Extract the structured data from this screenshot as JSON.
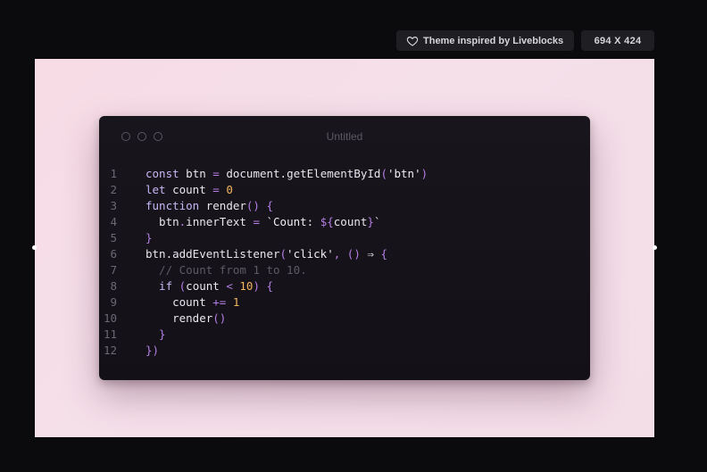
{
  "badges": {
    "theme_label": "Theme inspired by Liveblocks",
    "theme_icon": "heart-icon",
    "size_label": "694 X 424"
  },
  "window": {
    "title": "Untitled",
    "colors": {
      "background": "#16131a",
      "keyword": "#c7b7f6",
      "punctuation": "#b67ee6",
      "number": "#f3b55e",
      "comment": "#5e5966",
      "text": "#e9e6ee"
    }
  },
  "canvas": {
    "background_start": "#f7dbe5",
    "background_end": "#f3dde7"
  },
  "code": [
    {
      "n": "1",
      "tokens": [
        [
          "kw",
          "const"
        ],
        [
          "pl",
          " btn "
        ],
        [
          "pu",
          "="
        ],
        [
          "pl",
          " document.getElementById"
        ],
        [
          "pu",
          "("
        ],
        [
          "st",
          "'btn'"
        ],
        [
          "pu",
          ")"
        ]
      ]
    },
    {
      "n": "2",
      "tokens": [
        [
          "kw",
          "let"
        ],
        [
          "pl",
          " count "
        ],
        [
          "pu",
          "="
        ],
        [
          "pl",
          " "
        ],
        [
          "nu",
          "0"
        ]
      ]
    },
    {
      "n": "3",
      "tokens": [
        [
          "kw",
          "function"
        ],
        [
          "pl",
          " render"
        ],
        [
          "pu",
          "()"
        ],
        [
          "pl",
          " "
        ],
        [
          "pu",
          "{"
        ]
      ]
    },
    {
      "n": "4",
      "tokens": [
        [
          "pl",
          "  btn"
        ],
        [
          "pu",
          "."
        ],
        [
          "pl",
          "innerText "
        ],
        [
          "pu",
          "="
        ],
        [
          "pl",
          " "
        ],
        [
          "st",
          "`Count: "
        ],
        [
          "pu",
          "${"
        ],
        [
          "pl",
          "count"
        ],
        [
          "pu",
          "}"
        ],
        [
          "st",
          "`"
        ]
      ]
    },
    {
      "n": "5",
      "tokens": [
        [
          "pu",
          "}"
        ]
      ]
    },
    {
      "n": "6",
      "tokens": [
        [
          "pl",
          "btn.addEventListener"
        ],
        [
          "pu",
          "("
        ],
        [
          "st",
          "'click'"
        ],
        [
          "pu",
          ","
        ],
        [
          "pl",
          " "
        ],
        [
          "pu",
          "()"
        ],
        [
          "pl",
          " ⇒ "
        ],
        [
          "pu",
          "{"
        ]
      ]
    },
    {
      "n": "7",
      "tokens": [
        [
          "cm",
          "  // Count from 1 to 10."
        ]
      ]
    },
    {
      "n": "8",
      "tokens": [
        [
          "kw",
          "  if"
        ],
        [
          "pl",
          " "
        ],
        [
          "pu",
          "("
        ],
        [
          "pl",
          "count "
        ],
        [
          "pu",
          "<"
        ],
        [
          "pl",
          " "
        ],
        [
          "nu",
          "10"
        ],
        [
          "pu",
          ")"
        ],
        [
          "pl",
          " "
        ],
        [
          "pu",
          "{"
        ]
      ]
    },
    {
      "n": "9",
      "tokens": [
        [
          "pl",
          "    count "
        ],
        [
          "pu",
          "+="
        ],
        [
          "pl",
          " "
        ],
        [
          "nu",
          "1"
        ]
      ]
    },
    {
      "n": "10",
      "tokens": [
        [
          "pl",
          "    render"
        ],
        [
          "pu",
          "()"
        ]
      ]
    },
    {
      "n": "11",
      "tokens": [
        [
          "pu",
          "  }"
        ]
      ]
    },
    {
      "n": "12",
      "tokens": [
        [
          "pu",
          "})"
        ]
      ]
    }
  ]
}
